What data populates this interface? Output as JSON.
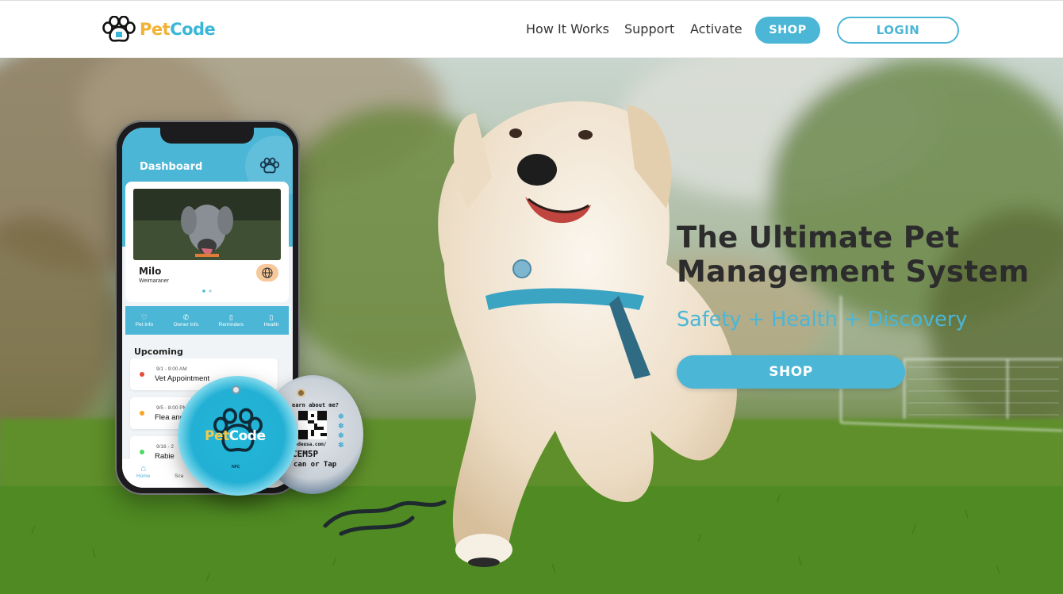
{
  "header": {
    "logo": {
      "pet": "Pet",
      "code": "Code"
    },
    "nav": [
      {
        "label": "How It Works"
      },
      {
        "label": "Support"
      },
      {
        "label": "Activate"
      }
    ],
    "shop_label": "SHOP",
    "login_label": "LOGIN"
  },
  "hero": {
    "headline_line1": "The Ultimate Pet",
    "headline_line2": "Management System",
    "tagline": "Safety + Health + Discovery",
    "shop_label": "SHOP"
  },
  "phone_app": {
    "title": "Dashboard",
    "pet": {
      "name": "Milo",
      "breed": "Weimaraner"
    },
    "quick_links": [
      {
        "icon": "heart-icon",
        "glyph": "♡",
        "label": "Pet Info"
      },
      {
        "icon": "phone-icon",
        "glyph": "✆",
        "label": "Owner Info"
      },
      {
        "icon": "clipboard-icon",
        "glyph": "▯",
        "label": "Reminders"
      },
      {
        "icon": "clipboard-icon",
        "glyph": "▯",
        "label": "Health"
      }
    ],
    "upcoming_title": "Upcoming",
    "appointments": [
      {
        "time": "9/1 - 9:00 AM",
        "title": "Vet Appointment",
        "color": "#e74c3c"
      },
      {
        "time": "9/5 - 8:00 PM",
        "title": "Flea and",
        "color": "#f5a623"
      },
      {
        "time": "9/16 - 2",
        "title": "Rabie",
        "color": "#4cd964"
      }
    ],
    "tabs": {
      "home": "Home",
      "scan": "Sca"
    }
  },
  "tags": {
    "front": {
      "brand_pet": "Pet",
      "brand_code": "Code",
      "nfc": "NFC"
    },
    "back": {
      "prompt": "earn about me?",
      "url": "codeusa.com/",
      "code": "CEM5P",
      "action": "can or Tap"
    }
  },
  "colors": {
    "brand_blue": "#4bb6d6",
    "brand_yellow": "#f2b233",
    "headline": "#2c2c2c"
  }
}
